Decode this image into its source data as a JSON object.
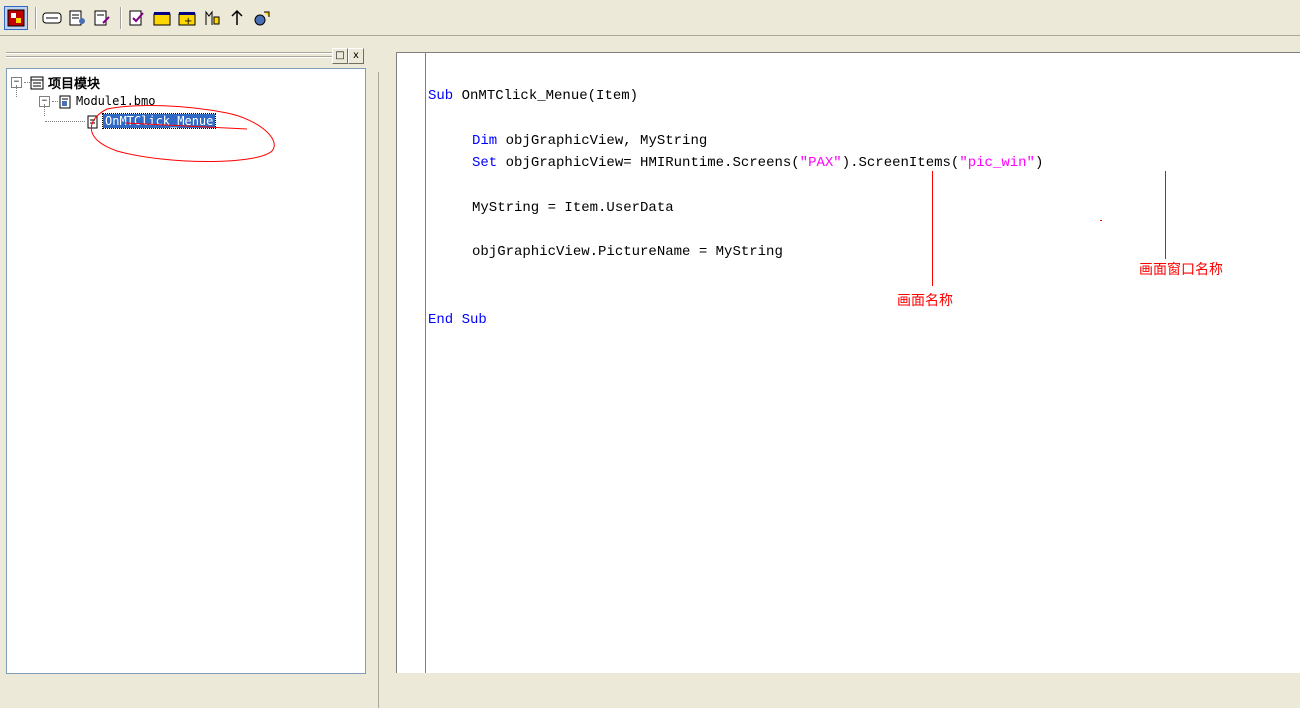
{
  "toolbar": {
    "buttons": [
      {
        "icon": "project-icon"
      },
      {
        "icon": "module-icon"
      },
      {
        "icon": "procedure-icon"
      },
      {
        "icon": "edit-procedure-icon"
      },
      {
        "icon": "check-syntax-icon"
      },
      {
        "icon": "new-module-icon"
      },
      {
        "icon": "add-procedure-icon"
      },
      {
        "icon": "bookmark-icon"
      },
      {
        "icon": "goto-icon"
      },
      {
        "icon": "reference-icon"
      }
    ]
  },
  "panel": {
    "restore_label": "□",
    "close_label": "x"
  },
  "tree": {
    "root_label": "项目模块",
    "module_label": "Module1.bmo",
    "procedure_label": "OnMTClick_Menue"
  },
  "code": {
    "lines": {
      "sub_kw": "Sub",
      "sub_rest": " OnMTClick_Menue(Item)",
      "dim_kw": "Dim",
      "dim_rest": " objGraphicView, MyString",
      "set_kw": "Set",
      "set_mid": " objGraphicView= HMIRuntime.Screens(",
      "set_str1": "\"PAX\"",
      "set_mid2": ").ScreenItems(",
      "set_str2": "\"pic_win\"",
      "set_end": ")",
      "mystring": "MyString = Item.UserData",
      "picturename": "objGraphicView.PictureName = MyString",
      "end_kw": "End Sub"
    }
  },
  "annotations": {
    "screen_name": "画面名称",
    "window_name": "画面窗口名称"
  },
  "colors": {
    "keyword": "#0000ff",
    "string": "#ff00ff",
    "annotation": "#ff0000",
    "selection": "#316ac5"
  }
}
